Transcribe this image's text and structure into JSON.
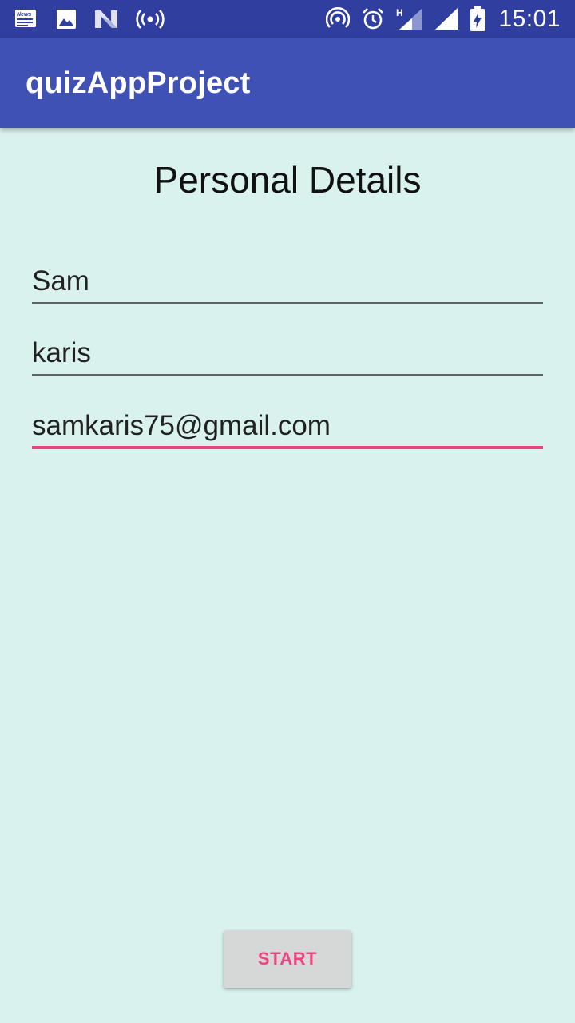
{
  "status_bar": {
    "left_icons": [
      "news-icon",
      "image-icon",
      "n-logo-icon",
      "hotspot-icon"
    ],
    "right_icons": [
      "hotspot-signal-icon",
      "alarm-icon",
      "signal-h-icon",
      "signal-icon",
      "battery-charging-icon"
    ],
    "network_type": "H",
    "time": "15:01",
    "colors": {
      "background": "#303f9f"
    }
  },
  "app_bar": {
    "title": "quizAppProject",
    "colors": {
      "background": "#3f51b5"
    }
  },
  "main": {
    "heading": "Personal Details",
    "fields": [
      {
        "value": "Sam"
      },
      {
        "value": "karis"
      },
      {
        "value": "samkaris75@gmail.com",
        "focused": true
      }
    ],
    "start_button": {
      "label": "START"
    }
  },
  "colors": {
    "background": "#daf2ee",
    "accent": "#ee4381",
    "button_bg": "#d6d7d7"
  }
}
